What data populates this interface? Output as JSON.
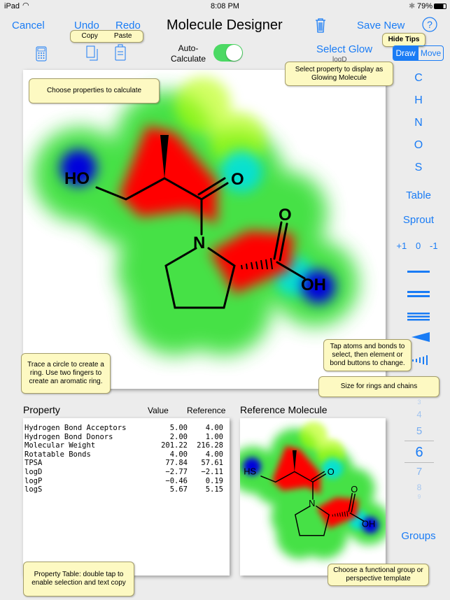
{
  "status": {
    "device": "iPad",
    "time": "8:08 PM",
    "battery": "79%"
  },
  "toolbar": {
    "cancel": "Cancel",
    "undo": "Undo",
    "redo": "Redo",
    "title": "Molecule Designer",
    "save_new": "Save New",
    "copy": "Copy",
    "paste": "Paste",
    "auto_calc": "Auto-\nCalculate",
    "auto_calc_on": true,
    "select_glow": "Select Glow",
    "glow_value": "logD",
    "draw": "Draw",
    "move": "Move",
    "mode": "Draw"
  },
  "tips": {
    "hide": "Hide Tips",
    "choose": "Choose properties to calculate",
    "glow": "Select property to display as Glowing Molecule",
    "ring": "Trace a circle to create a ring.  Use two fingers to create an aromatic ring.",
    "select": "Tap atoms and bonds to select, then element or bond buttons to change.",
    "size": "Size for rings and chains",
    "table": "Property Table:  double tap to enable selection and text copy",
    "groups": "Choose a functional group or perspective template"
  },
  "molecule": {
    "labels": {
      "ho": "HO",
      "o1": "O",
      "n": "N",
      "o2": "O",
      "oh": "OH"
    }
  },
  "reference": {
    "title": "Reference Molecule",
    "labels": {
      "hs": "HS",
      "o1": "O",
      "n": "N",
      "o2": "O",
      "oh": "OH"
    }
  },
  "sidebar": {
    "elements": [
      "C",
      "H",
      "N",
      "O",
      "S"
    ],
    "table": "Table",
    "sprout": "Sprout",
    "charges": [
      "+1",
      "0",
      "-1"
    ],
    "ring_sizes": [
      "3",
      "4",
      "5",
      "6",
      "7",
      "8",
      "9"
    ],
    "selected_size": "6",
    "groups": "Groups"
  },
  "properties": {
    "headers": [
      "Property",
      "Value",
      "Reference"
    ],
    "rows": [
      {
        "name": "Hydrogen Bond Acceptors",
        "value": "5.00",
        "ref": "4.00"
      },
      {
        "name": "Hydrogen Bond Donors",
        "value": "2.00",
        "ref": "1.00"
      },
      {
        "name": "Molecular Weight",
        "value": "201.22",
        "ref": "216.28"
      },
      {
        "name": "Rotatable Bonds",
        "value": "4.00",
        "ref": "4.00"
      },
      {
        "name": "TPSA",
        "value": "77.84",
        "ref": "57.61"
      },
      {
        "name": "logD",
        "value": "−2.77",
        "ref": "−2.11"
      },
      {
        "name": "logP",
        "value": "−0.46",
        "ref": "0.19"
      },
      {
        "name": "logS",
        "value": "5.67",
        "ref": "5.15"
      }
    ]
  },
  "colors": {
    "accent": "#1a7cf5",
    "tip_bg": "#fdf9c2",
    "glow_high": "#ff0000",
    "glow_mid": "#22dd22",
    "glow_low": "#0000dd",
    "toggle_on": "#4cd964"
  }
}
